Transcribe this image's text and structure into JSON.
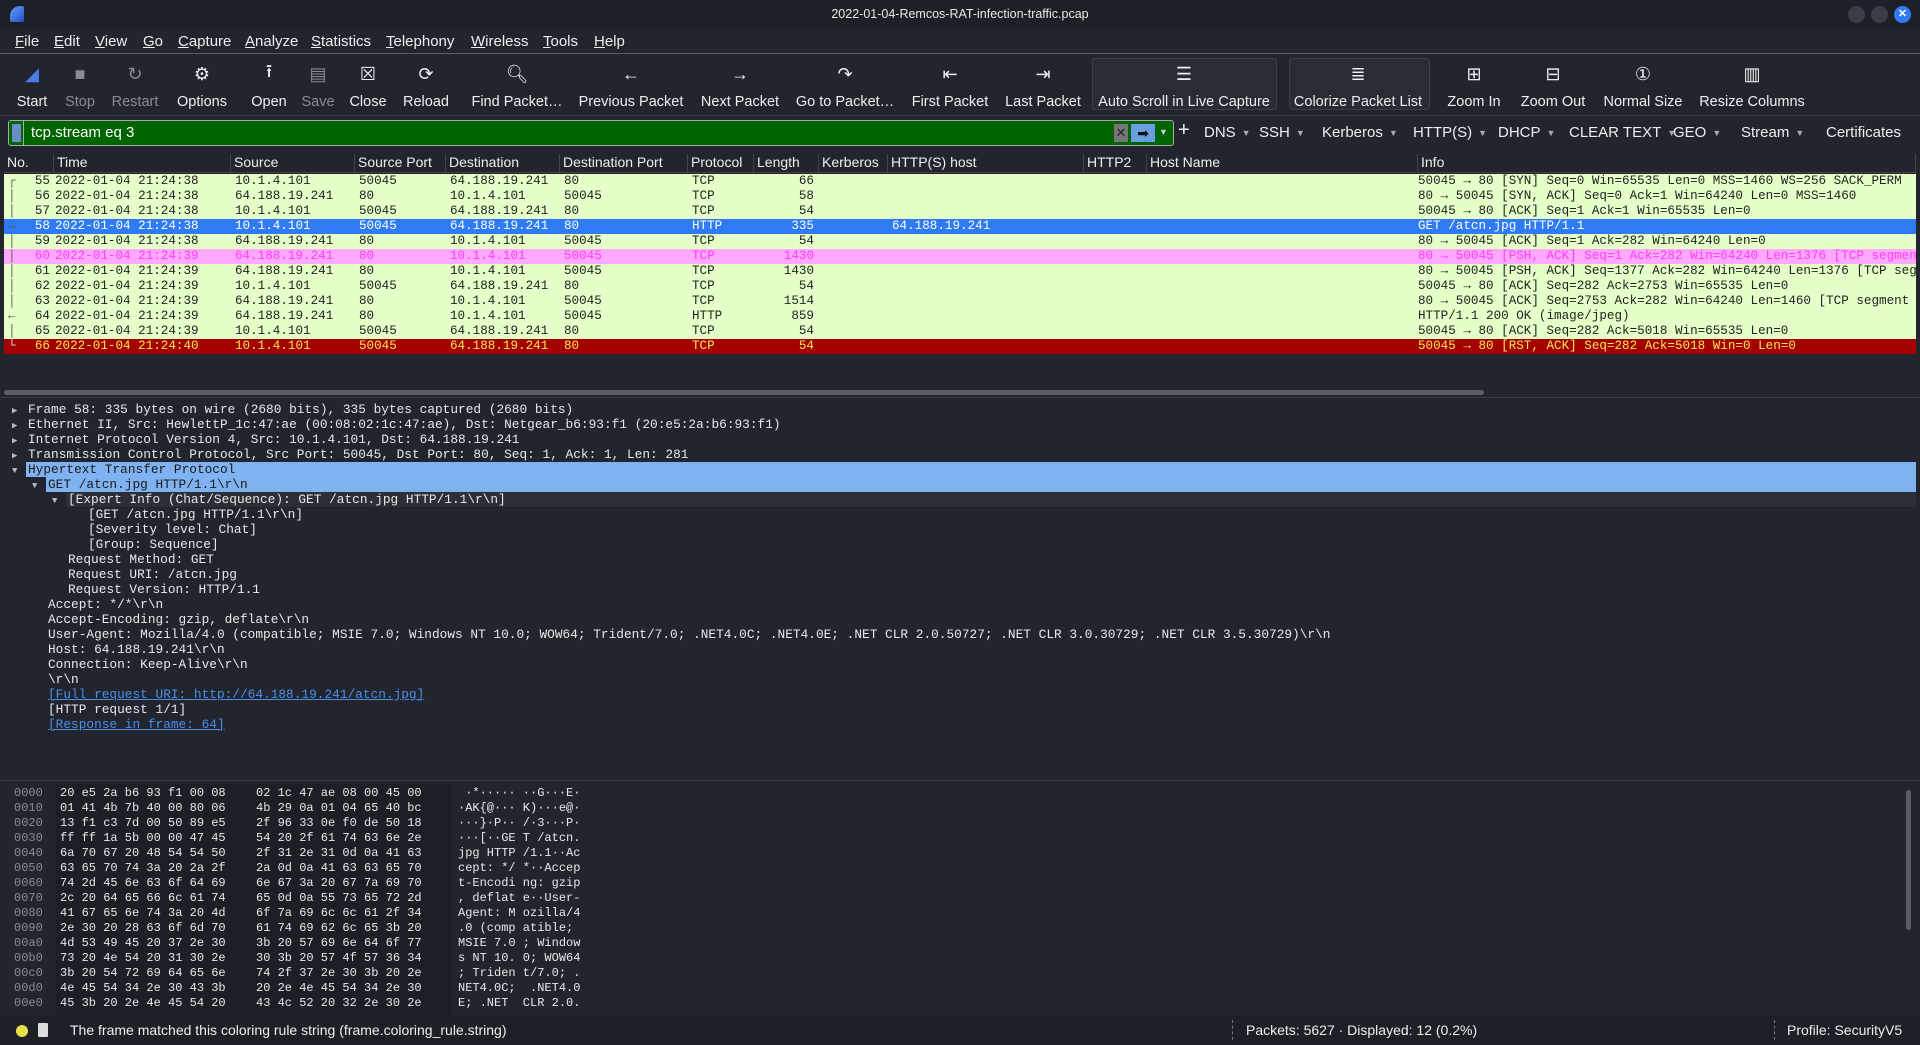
{
  "window": {
    "title": "2022-01-04-Remcos-RAT-infection-traffic.pcap"
  },
  "menu": [
    "File",
    "Edit",
    "View",
    "Go",
    "Capture",
    "Analyze",
    "Statistics",
    "Telephony",
    "Wireless",
    "Tools",
    "Help"
  ],
  "toolbar": [
    {
      "label": "Start",
      "icon": "shark-fin-icon",
      "enabled": true
    },
    {
      "label": "Stop",
      "icon": "stop-icon",
      "enabled": false
    },
    {
      "label": "Restart",
      "icon": "restart-icon",
      "enabled": false
    },
    {
      "label": "Options",
      "icon": "gear-icon",
      "enabled": true
    },
    {
      "label": "Open",
      "icon": "open-icon",
      "enabled": true
    },
    {
      "label": "Save",
      "icon": "save-icon",
      "enabled": false
    },
    {
      "label": "Close",
      "icon": "close-file-icon",
      "enabled": true
    },
    {
      "label": "Reload",
      "icon": "reload-icon",
      "enabled": true
    },
    {
      "label": "Find Packet…",
      "icon": "search-icon",
      "enabled": true
    },
    {
      "label": "Previous Packet",
      "icon": "arrow-left-icon",
      "enabled": true
    },
    {
      "label": "Next Packet",
      "icon": "arrow-right-icon",
      "enabled": true
    },
    {
      "label": "Go to Packet…",
      "icon": "go-to-icon",
      "enabled": true
    },
    {
      "label": "First Packet",
      "icon": "first-icon",
      "enabled": true
    },
    {
      "label": "Last Packet",
      "icon": "last-icon",
      "enabled": true
    },
    {
      "label": "Auto Scroll in Live Capture",
      "icon": "autoscroll-icon",
      "enabled": true
    },
    {
      "label": "Colorize Packet List",
      "icon": "colorize-icon",
      "enabled": true
    },
    {
      "label": "Zoom In",
      "icon": "zoom-in-icon",
      "enabled": true
    },
    {
      "label": "Zoom Out",
      "icon": "zoom-out-icon",
      "enabled": true
    },
    {
      "label": "Normal Size",
      "icon": "normal-size-icon",
      "enabled": true
    },
    {
      "label": "Resize Columns",
      "icon": "resize-columns-icon",
      "enabled": true
    }
  ],
  "filter": {
    "value": "tcp.stream eq 3",
    "bg": "#006400"
  },
  "filter_buttons": [
    {
      "label": "DNS",
      "dropdown": true
    },
    {
      "label": "SSH",
      "dropdown": true
    },
    {
      "label": "Kerberos",
      "dropdown": true
    },
    {
      "label": "HTTP(S)",
      "dropdown": true
    },
    {
      "label": "DHCP",
      "dropdown": true
    },
    {
      "label": "CLEAR TEXT",
      "dropdown": true
    },
    {
      "label": "GEO",
      "dropdown": true
    },
    {
      "label": "Stream",
      "dropdown": true
    },
    {
      "label": "Certificates",
      "dropdown": false
    }
  ],
  "columns": [
    "No.",
    "Time",
    "Source",
    "Source Port",
    "Destination",
    "Destination Port",
    "Protocol",
    "Length",
    "Kerberos",
    "HTTP(S) host",
    "HTTP2",
    "Host Name",
    "Info"
  ],
  "packets": [
    {
      "no": "55",
      "time": "2022-01-04 21:24:38",
      "src": "10.1.4.101",
      "sport": "50045",
      "dst": "64.188.19.241",
      "dport": "80",
      "proto": "TCP",
      "len": "66",
      "host": "",
      "info": "50045 → 80 [SYN] Seq=0 Win=65535 Len=0 MSS=1460 WS=256 SACK_PERM",
      "style": "normal"
    },
    {
      "no": "56",
      "time": "2022-01-04 21:24:38",
      "src": "64.188.19.241",
      "sport": "80",
      "dst": "10.1.4.101",
      "dport": "50045",
      "proto": "TCP",
      "len": "58",
      "host": "",
      "info": "80 → 50045 [SYN, ACK] Seq=0 Ack=1 Win=64240 Len=0 MSS=1460",
      "style": "normal"
    },
    {
      "no": "57",
      "time": "2022-01-04 21:24:38",
      "src": "10.1.4.101",
      "sport": "50045",
      "dst": "64.188.19.241",
      "dport": "80",
      "proto": "TCP",
      "len": "54",
      "host": "",
      "info": "50045 → 80 [ACK] Seq=1 Ack=1 Win=65535 Len=0",
      "style": "normal"
    },
    {
      "no": "58",
      "time": "2022-01-04 21:24:38",
      "src": "10.1.4.101",
      "sport": "50045",
      "dst": "64.188.19.241",
      "dport": "80",
      "proto": "HTTP",
      "len": "335",
      "host": "64.188.19.241",
      "info": "GET /atcn.jpg HTTP/1.1",
      "style": "sel"
    },
    {
      "no": "59",
      "time": "2022-01-04 21:24:38",
      "src": "64.188.19.241",
      "sport": "80",
      "dst": "10.1.4.101",
      "dport": "50045",
      "proto": "TCP",
      "len": "54",
      "host": "",
      "info": "80 → 50045 [ACK] Seq=1 Ack=282 Win=64240 Len=0",
      "style": "normal"
    },
    {
      "no": "60",
      "time": "2022-01-04 21:24:39",
      "src": "64.188.19.241",
      "sport": "80",
      "dst": "10.1.4.101",
      "dport": "50045",
      "proto": "TCP",
      "len": "1430",
      "host": "",
      "info": "80 → 50045 [PSH, ACK] Seq=1 Ack=282 Win=64240 Len=1376 [TCP segment",
      "style": "pink"
    },
    {
      "no": "61",
      "time": "2022-01-04 21:24:39",
      "src": "64.188.19.241",
      "sport": "80",
      "dst": "10.1.4.101",
      "dport": "50045",
      "proto": "TCP",
      "len": "1430",
      "host": "",
      "info": "80 → 50045 [PSH, ACK] Seq=1377 Ack=282 Win=64240 Len=1376 [TCP segment",
      "style": "normal"
    },
    {
      "no": "62",
      "time": "2022-01-04 21:24:39",
      "src": "10.1.4.101",
      "sport": "50045",
      "dst": "64.188.19.241",
      "dport": "80",
      "proto": "TCP",
      "len": "54",
      "host": "",
      "info": "50045 → 80 [ACK] Seq=282 Ack=2753 Win=65535 Len=0",
      "style": "normal"
    },
    {
      "no": "63",
      "time": "2022-01-04 21:24:39",
      "src": "64.188.19.241",
      "sport": "80",
      "dst": "10.1.4.101",
      "dport": "50045",
      "proto": "TCP",
      "len": "1514",
      "host": "",
      "info": "80 → 50045 [ACK] Seq=2753 Ack=282 Win=64240 Len=1460 [TCP segment",
      "style": "normal"
    },
    {
      "no": "64",
      "time": "2022-01-04 21:24:39",
      "src": "64.188.19.241",
      "sport": "80",
      "dst": "10.1.4.101",
      "dport": "50045",
      "proto": "HTTP",
      "len": "859",
      "host": "",
      "info": "HTTP/1.1 200 OK  (image/jpeg)",
      "style": "normal"
    },
    {
      "no": "65",
      "time": "2022-01-04 21:24:39",
      "src": "10.1.4.101",
      "sport": "50045",
      "dst": "64.188.19.241",
      "dport": "80",
      "proto": "TCP",
      "len": "54",
      "host": "",
      "info": "50045 → 80 [ACK] Seq=282 Ack=5018 Win=65535 Len=0",
      "style": "normal"
    },
    {
      "no": "66",
      "time": "2022-01-04 21:24:40",
      "src": "10.1.4.101",
      "sport": "50045",
      "dst": "64.188.19.241",
      "dport": "80",
      "proto": "TCP",
      "len": "54",
      "host": "",
      "info": "50045 → 80 [RST, ACK] Seq=282 Ack=5018 Win=0 Len=0",
      "style": "red"
    }
  ],
  "details": [
    {
      "level": 0,
      "exp": "collapsed",
      "text": "Frame 58: 335 bytes on wire (2680 bits), 335 bytes captured (2680 bits)"
    },
    {
      "level": 0,
      "exp": "collapsed",
      "text": "Ethernet II, Src: HewlettP_1c:47:ae (00:08:02:1c:47:ae), Dst: Netgear_b6:93:f1 (20:e5:2a:b6:93:f1)"
    },
    {
      "level": 0,
      "exp": "collapsed",
      "text": "Internet Protocol Version 4, Src: 10.1.4.101, Dst: 64.188.19.241"
    },
    {
      "level": 0,
      "exp": "collapsed",
      "text": "Transmission Control Protocol, Src Port: 50045, Dst Port: 80, Seq: 1, Ack: 1, Len: 281"
    },
    {
      "level": 0,
      "exp": "expanded",
      "text": "Hypertext Transfer Protocol",
      "style": "hl"
    },
    {
      "level": 1,
      "exp": "expanded",
      "text": "GET /atcn.jpg HTTP/1.1\\r\\n",
      "style": "hl"
    },
    {
      "level": 2,
      "exp": "expanded",
      "text": "[Expert Info (Chat/Sequence): GET /atcn.jpg HTTP/1.1\\r\\n]",
      "style": "sub"
    },
    {
      "level": 3,
      "exp": "none",
      "text": "[GET /atcn.jpg HTTP/1.1\\r\\n]"
    },
    {
      "level": 3,
      "exp": "none",
      "text": "[Severity level: Chat]"
    },
    {
      "level": 3,
      "exp": "none",
      "text": "[Group: Sequence]"
    },
    {
      "level": 2,
      "exp": "none",
      "text": "Request Method: GET"
    },
    {
      "level": 2,
      "exp": "none",
      "text": "Request URI: /atcn.jpg"
    },
    {
      "level": 2,
      "exp": "none",
      "text": "Request Version: HTTP/1.1"
    },
    {
      "level": 1,
      "exp": "none",
      "text": "Accept: */*\\r\\n"
    },
    {
      "level": 1,
      "exp": "none",
      "text": "Accept-Encoding: gzip, deflate\\r\\n"
    },
    {
      "level": 1,
      "exp": "none",
      "text": "User-Agent: Mozilla/4.0 (compatible; MSIE 7.0; Windows NT 10.0; WOW64; Trident/7.0; .NET4.0C; .NET4.0E; .NET CLR 2.0.50727; .NET CLR 3.0.30729; .NET CLR 3.5.30729)\\r\\n"
    },
    {
      "level": 1,
      "exp": "none",
      "text": "Host: 64.188.19.241\\r\\n"
    },
    {
      "level": 1,
      "exp": "none",
      "text": "Connection: Keep-Alive\\r\\n"
    },
    {
      "level": 1,
      "exp": "none",
      "text": "\\r\\n"
    },
    {
      "level": 1,
      "exp": "none",
      "text": "[Full request URI: http://64.188.19.241/atcn.jpg]",
      "style": "link"
    },
    {
      "level": 1,
      "exp": "none",
      "text": "[HTTP request 1/1]"
    },
    {
      "level": 1,
      "exp": "none",
      "text": "[Response in frame: 64]",
      "style": "link"
    }
  ],
  "hex": [
    {
      "off": "0000",
      "h1": "20 e5 2a b6 93 f1 00 08",
      "h2": "02 1c 47 ae 08 00 45 00",
      "asc": " ·*····· ··G···E·"
    },
    {
      "off": "0010",
      "h1": "01 41 4b 7b 40 00 80 06",
      "h2": "4b 29 0a 01 04 65 40 bc",
      "asc": "·AK{@··· K)···e@·"
    },
    {
      "off": "0020",
      "h1": "13 f1 c3 7d 00 50 89 e5",
      "h2": "2f 96 33 0e f0 de 50 18",
      "asc": "···}·P·· /·3···P·"
    },
    {
      "off": "0030",
      "h1": "ff ff 1a 5b 00 00 47 45",
      "h2": "54 20 2f 61 74 63 6e 2e",
      "asc": "···[··GE T /atcn."
    },
    {
      "off": "0040",
      "h1": "6a 70 67 20 48 54 54 50",
      "h2": "2f 31 2e 31 0d 0a 41 63",
      "asc": "jpg HTTP /1.1··Ac"
    },
    {
      "off": "0050",
      "h1": "63 65 70 74 3a 20 2a 2f",
      "h2": "2a 0d 0a 41 63 63 65 70",
      "asc": "cept: */ *··Accep"
    },
    {
      "off": "0060",
      "h1": "74 2d 45 6e 63 6f 64 69",
      "h2": "6e 67 3a 20 67 7a 69 70",
      "asc": "t-Encodi ng: gzip"
    },
    {
      "off": "0070",
      "h1": "2c 20 64 65 66 6c 61 74",
      "h2": "65 0d 0a 55 73 65 72 2d",
      "asc": ", deflat e··User-"
    },
    {
      "off": "0080",
      "h1": "41 67 65 6e 74 3a 20 4d",
      "h2": "6f 7a 69 6c 6c 61 2f 34",
      "asc": "Agent: M ozilla/4"
    },
    {
      "off": "0090",
      "h1": "2e 30 20 28 63 6f 6d 70",
      "h2": "61 74 69 62 6c 65 3b 20",
      "asc": ".0 (comp atible; "
    },
    {
      "off": "00a0",
      "h1": "4d 53 49 45 20 37 2e 30",
      "h2": "3b 20 57 69 6e 64 6f 77",
      "asc": "MSIE 7.0 ; Window"
    },
    {
      "off": "00b0",
      "h1": "73 20 4e 54 20 31 30 2e",
      "h2": "30 3b 20 57 4f 57 36 34",
      "asc": "s NT 10. 0; WOW64"
    },
    {
      "off": "00c0",
      "h1": "3b 20 54 72 69 64 65 6e",
      "h2": "74 2f 37 2e 30 3b 20 2e",
      "asc": "; Triden t/7.0; ."
    },
    {
      "off": "00d0",
      "h1": "4e 45 54 34 2e 30 43 3b",
      "h2": "20 2e 4e 45 54 34 2e 30",
      "asc": "NET4.0C;  .NET4.0"
    },
    {
      "off": "00e0",
      "h1": "45 3b 20 2e 4e 45 54 20",
      "h2": "43 4c 52 20 32 2e 30 2e",
      "asc": "E; .NET  CLR 2.0."
    }
  ],
  "status": {
    "message": "The frame matched this coloring rule string (frame.coloring_rule.string)",
    "packets": "Packets: 5627 · Displayed: 12 (0.2%)",
    "profile": "Profile: SecurityV5"
  },
  "colors": {
    "row_normal": "#e4ffc7",
    "row_selected": "#2f7bf5",
    "row_pink": "#ffa8ff",
    "row_red": "#a40000",
    "detail_highlight": "#7fb2f0"
  }
}
